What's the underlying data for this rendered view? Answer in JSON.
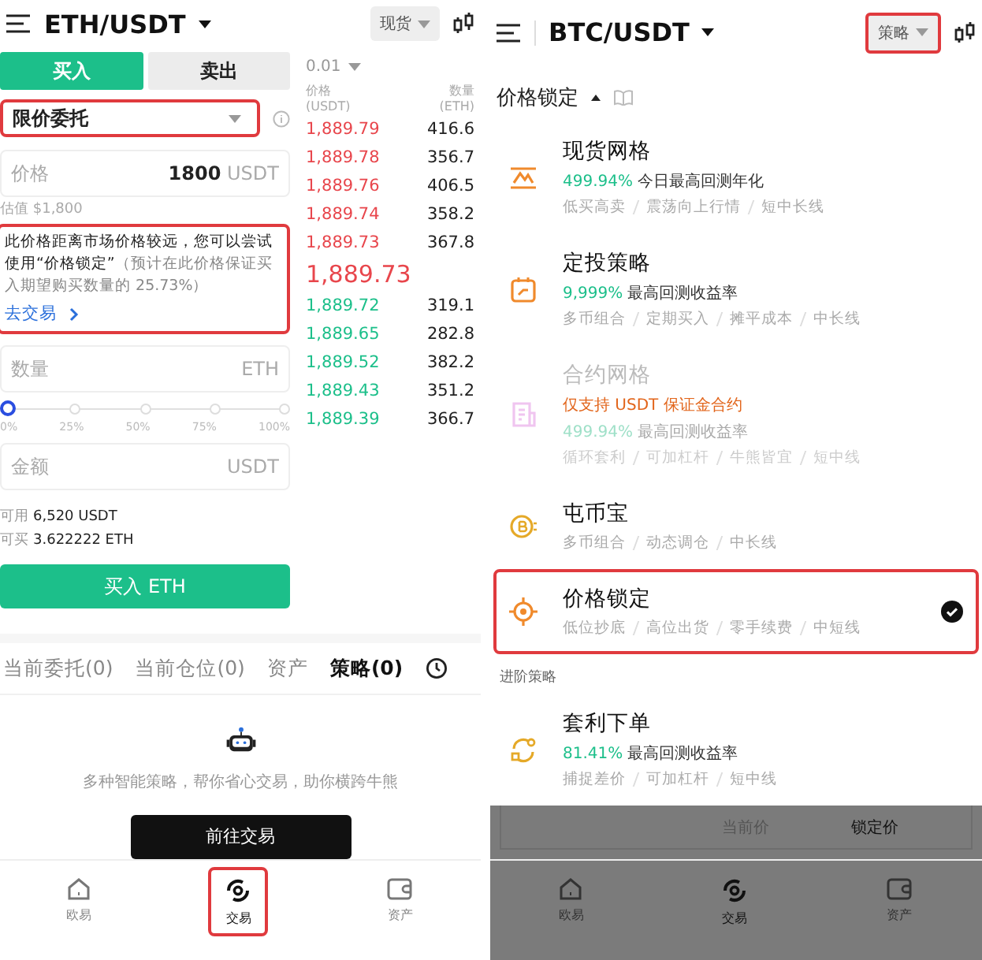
{
  "left": {
    "header": {
      "pair": "ETH/USDT",
      "market": "现货"
    },
    "side_tabs": [
      {
        "label": "买入",
        "selected": true
      },
      {
        "label": "卖出",
        "selected": false
      }
    ],
    "order_type": {
      "value": "限价委托",
      "highlighted": true
    },
    "price_field": {
      "label": "价格",
      "value": "1800",
      "unit": "USDT"
    },
    "estimate": "估值 $1,800",
    "notice": {
      "text": "此价格距离市场价格较远，您可以尝试使用“价格锁定”",
      "note": "（预计在此价格保证买入期望购买数量的 25.73%）",
      "link": "去交易",
      "highlighted": true
    },
    "quantity_field": {
      "placeholder": "数量",
      "unit": "ETH"
    },
    "slider": {
      "level": 0,
      "ticks": [
        "0%",
        "25%",
        "50%",
        "75%",
        "100%"
      ]
    },
    "amount_field": {
      "placeholder": "金额",
      "unit": "USDT"
    },
    "balances": [
      {
        "label": "可用",
        "value": "6,520 USDT"
      },
      {
        "label": "可买",
        "value": "3.622222 ETH"
      }
    ],
    "buy_button": "买入 ETH",
    "order_book": {
      "precision": "0.01",
      "columns": [
        {
          "label": "价格",
          "unit": "(USDT)"
        },
        {
          "label": "数量",
          "unit": "(ETH)"
        }
      ],
      "asks": [
        {
          "price": "1,889.79",
          "amount": "416.6"
        },
        {
          "price": "1,889.78",
          "amount": "356.7"
        },
        {
          "price": "1,889.76",
          "amount": "406.5"
        },
        {
          "price": "1,889.74",
          "amount": "358.2"
        },
        {
          "price": "1,889.73",
          "amount": "367.8"
        }
      ],
      "last_price": "1,889.73",
      "bids": [
        {
          "price": "1,889.72",
          "amount": "319.1"
        },
        {
          "price": "1,889.65",
          "amount": "282.8"
        },
        {
          "price": "1,889.52",
          "amount": "382.2"
        },
        {
          "price": "1,889.43",
          "amount": "351.2"
        },
        {
          "price": "1,889.39",
          "amount": "366.7"
        }
      ]
    },
    "bottom_tabs": [
      {
        "label": "当前委托(0)",
        "selected": false
      },
      {
        "label": "当前仓位(0)",
        "selected": false
      },
      {
        "label": "资产",
        "selected": false
      },
      {
        "label": "策略(0)",
        "selected": true
      }
    ],
    "empty_state": {
      "text": "多种智能策略，帮你省心交易，助你横跨牛熊",
      "button": "前往交易"
    },
    "nav": [
      {
        "label": "欧易",
        "kind": "home",
        "selected": false,
        "highlighted": false
      },
      {
        "label": "交易",
        "kind": "trade",
        "selected": true,
        "highlighted": true
      },
      {
        "label": "资产",
        "kind": "wallet",
        "selected": false,
        "highlighted": false
      }
    ]
  },
  "right": {
    "header": {
      "pair": "BTC/USDT",
      "mode": "策略",
      "mode_highlighted": true
    },
    "section_title": "价格锁定",
    "strategies": [
      {
        "kind": "grid",
        "title": "现货网格",
        "rate": "499.94%",
        "rate_label": "今日最高回测年化",
        "tags": [
          "低买高卖",
          "震荡向上行情",
          "短中长线"
        ],
        "disabled": false,
        "selected": false,
        "highlighted": false
      },
      {
        "kind": "calendar",
        "title": "定投策略",
        "rate": "9,999%",
        "rate_label": "最高回测收益率",
        "tags": [
          "多币组合",
          "定期买入",
          "摊平成本",
          "中长线"
        ],
        "disabled": false,
        "selected": false,
        "highlighted": false
      },
      {
        "kind": "contract",
        "title": "合约网格",
        "warning": "仅支持 USDT 保证金合约",
        "rate": "499.94%",
        "rate_label": "最高回测收益率",
        "tags": [
          "循环套利",
          "可加杠杆",
          "牛熊皆宜",
          "短中线"
        ],
        "disabled": true,
        "selected": false,
        "highlighted": false
      },
      {
        "kind": "coin",
        "title": "屯币宝",
        "tags": [
          "多币组合",
          "动态调仓",
          "中长线"
        ],
        "disabled": false,
        "selected": false,
        "highlighted": false
      },
      {
        "kind": "target",
        "title": "价格锁定",
        "tags": [
          "低位抄底",
          "高位出货",
          "零手续费",
          "中短线"
        ],
        "disabled": false,
        "selected": true,
        "highlighted": true
      }
    ],
    "advanced_label": "进阶策略",
    "advanced": [
      {
        "kind": "arbitrage",
        "title": "套利下单",
        "rate": "81.41%",
        "rate_label": "最高回测收益率",
        "tags": [
          "捕捉差价",
          "可加杠杆",
          "短中线"
        ],
        "disabled": false,
        "selected": false,
        "highlighted": false
      }
    ],
    "background": {
      "labels": [
        "当前价",
        "锁定价"
      ]
    },
    "nav": [
      {
        "label": "欧易",
        "kind": "home",
        "selected": false
      },
      {
        "label": "交易",
        "kind": "trade",
        "selected": true
      },
      {
        "label": "资产",
        "kind": "wallet",
        "selected": false
      }
    ]
  }
}
